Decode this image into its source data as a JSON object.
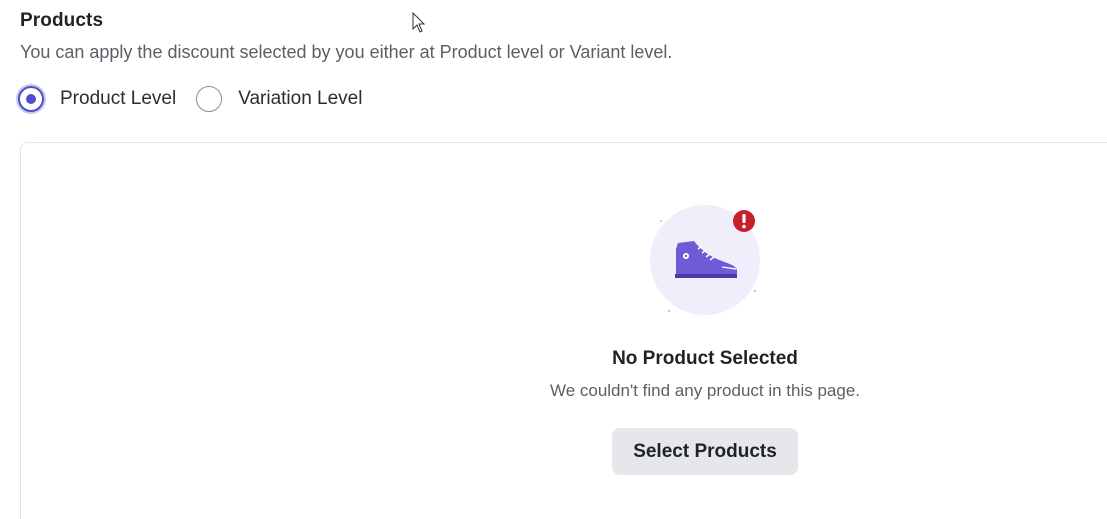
{
  "products": {
    "title": "Products",
    "description": "You can apply the discount selected by you either at Product level or Variant level.",
    "level_options": [
      {
        "label": "Product Level",
        "selected": true
      },
      {
        "label": "Variation Level",
        "selected": false
      }
    ]
  },
  "empty_state": {
    "title": "No Product Selected",
    "description": "We couldn't find any product in this page.",
    "button_label": "Select Products",
    "illustration_icon": "sneaker-icon",
    "alert_icon": "exclamation-badge-icon"
  },
  "colors": {
    "accent": "#4c4fc7",
    "illustration_bg": "#efeefb",
    "sneaker": "#6f5bd6",
    "alert": "#c8202a",
    "button_bg": "#e6e7ea"
  }
}
